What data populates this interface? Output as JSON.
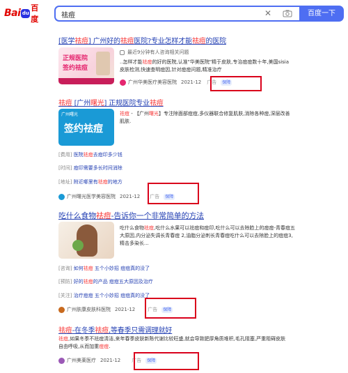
{
  "search": {
    "query": "祛痘",
    "button_label": "百度一下",
    "logo_text_bai": "Bai",
    "logo_text_du": "du",
    "logo_text_cn": "百度"
  },
  "results": [
    {
      "title_parts": [
        "[医学",
        "祛痘",
        "] 广州好的",
        "祛痘",
        "医院?专业怎样才能",
        "祛痘",
        "的医院"
      ],
      "thumb_lines": [
        "正规医院",
        "签约祛痘"
      ],
      "notice": "最近9分钟有人咨询相关问题",
      "snippet_parts": [
        "..怎样才能",
        "祛痘",
        "的好的医院,认准\"华美医院\"精于皮肤,专治痘痘数十年,美国sisia皮肤检测,快速查明痘因,针对痘痘问题,精准治疗"
      ],
      "source": "广州华美医疗美容医院",
      "date": "2021-12",
      "ad_label": "广告",
      "shield_label": "保障"
    },
    {
      "title_parts": [
        "祛痘",
        " [广州",
        "曙光",
        "] 正规医院专业",
        "祛痘"
      ],
      "thumb_brand": "广州曙光",
      "thumb_lines": [
        "签约祛痘"
      ],
      "snippet_parts": [
        "祛痘",
        " - 【广州",
        "曙光",
        "】专注除面部痘痘,多仪器联合修复肌肤,消除各种痘,深层改善肌肤."
      ],
      "links": [
        {
          "tag": "[费用]",
          "text": "医院",
          "hl": "祛痘",
          "rest": "去痘印多少钱"
        },
        {
          "tag": "[时间]",
          "text": "痘印需要多长时间消除",
          "hl": "",
          "rest": ""
        },
        {
          "tag": "[地址]",
          "text": "附近哪里有",
          "hl": "祛痘",
          "rest": "的地方"
        }
      ],
      "source": "广州曙光医学美容医院",
      "date": "2021-12",
      "ad_label": "广告",
      "shield_label": "保障"
    },
    {
      "title_parts": [
        "吃什么食物",
        "祛痘",
        "-告诉你一个非常简单的方法"
      ],
      "snippet_parts": [
        "吃什么食物",
        "祛痘",
        ",吃什么水果可以祛痘和痘印,吃什么可以去除脸上的痘痘-青春痘五大原因,内分泌失调长青春痘 2,油脂分泌刺长青春痘吃什么可以去除脸上的痘痘3,精击多染长..."
      ],
      "links": [
        {
          "tag": "[咨询]",
          "text": "如何",
          "hl": "祛痘",
          "rest": " 五个小妙招 痘痘真的没了"
        },
        {
          "tag": "[预防]",
          "text": "好的",
          "hl": "祛痘",
          "rest": "的产品 痘痘五大原因及治疗"
        },
        {
          "tag": "[关注]",
          "text": "治疗痘痘",
          "hl": "",
          "rest": " 五个小妙招 痘痘真的没了"
        }
      ],
      "source": "广州肤康皮肤科医院",
      "date": "2021-12",
      "ad_label": "广告",
      "shield_label": "保障"
    },
    {
      "title_parts": [
        "祛痘",
        "-在冬季",
        "祛痘",
        ",等春季只需调理就好"
      ],
      "snippet_parts": [
        "祛痘",
        ",如果冬季不祛痘清洁,来年春季皮肤新陈代谢比较旺盛,就会导致肥厚角质堆积,毛孔阻塞,严重阻碍皮肤自由呼吸,从而加重",
        "痘痘",
        "."
      ],
      "source": "广州美莱医疗",
      "date": "2021-12",
      "ad_label": "广告",
      "shield_label": "保障"
    }
  ]
}
